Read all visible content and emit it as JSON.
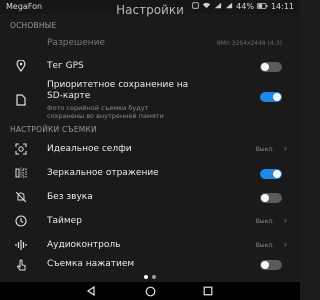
{
  "status_bar": {
    "carrier": "MegaFon",
    "battery": "44%",
    "time": "14:11"
  },
  "header": {
    "title": "Настройки"
  },
  "sections": {
    "basic": "ОСНОВНЫЕ",
    "shooting": "НАСТРОЙКИ СЪЕМКИ"
  },
  "items": {
    "resolution": {
      "label": "Разрешение",
      "value": "8Мп 3264x2448 (4:3)",
      "icon": "none"
    },
    "gps": {
      "label": "Тег GPS",
      "enabled": false,
      "icon": "location-pin-icon"
    },
    "sd_priority": {
      "label_line1": "Приоритетное сохранение на",
      "label_line2": "SD-карте",
      "sub_line1": "Фото серийной съемки будут",
      "sub_line2": "сохранены во внутренней памяти",
      "enabled": true,
      "icon": "sd-card-icon"
    },
    "selfie": {
      "label": "Идеальное селфи",
      "value": "Выкл.",
      "icon": "selfie-face-icon"
    },
    "mirror": {
      "label": "Зеркальное отражение",
      "enabled": true,
      "icon": "mirror-icon"
    },
    "silent": {
      "label": "Без звука",
      "enabled": false,
      "icon": "mute-bell-icon"
    },
    "timer": {
      "label": "Таймер",
      "value": "Выкл.",
      "icon": "timer-clock-icon"
    },
    "audio": {
      "label": "Аудиоконтроль",
      "value": "Выкл.",
      "icon": "audio-waveform-icon"
    },
    "touch": {
      "label": "Съемка нажатием",
      "enabled": false,
      "icon": "tap-hand-icon"
    }
  },
  "colors": {
    "accent": "#1e88e5",
    "background": "#1a1a1a"
  }
}
